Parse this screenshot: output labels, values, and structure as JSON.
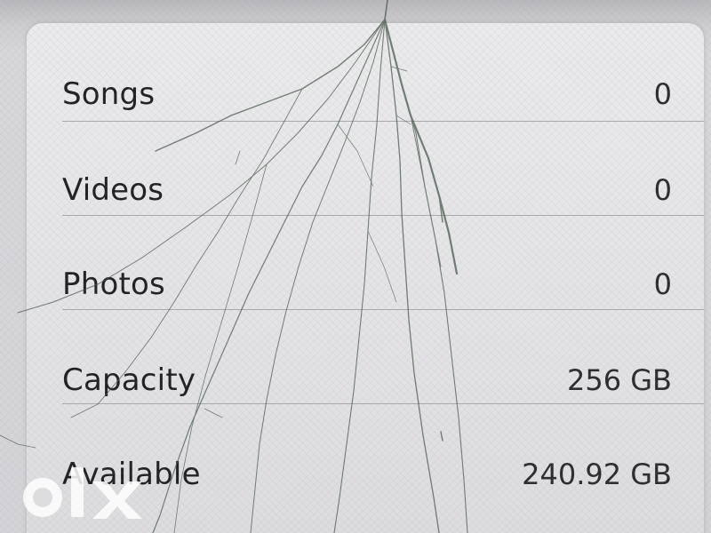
{
  "storage": {
    "rows": [
      {
        "label": "Songs",
        "value": "0"
      },
      {
        "label": "Videos",
        "value": "0"
      },
      {
        "label": "Photos",
        "value": "0"
      },
      {
        "label": "Capacity",
        "value": "256 GB"
      },
      {
        "label": "Available",
        "value": "240.92 GB"
      }
    ]
  },
  "watermark": {
    "text": "olx"
  },
  "colors": {
    "card_background": "#e6e6e9",
    "text": "#1f1f24",
    "divider": "#a9a9ae",
    "crack": "#4a5a4e"
  }
}
